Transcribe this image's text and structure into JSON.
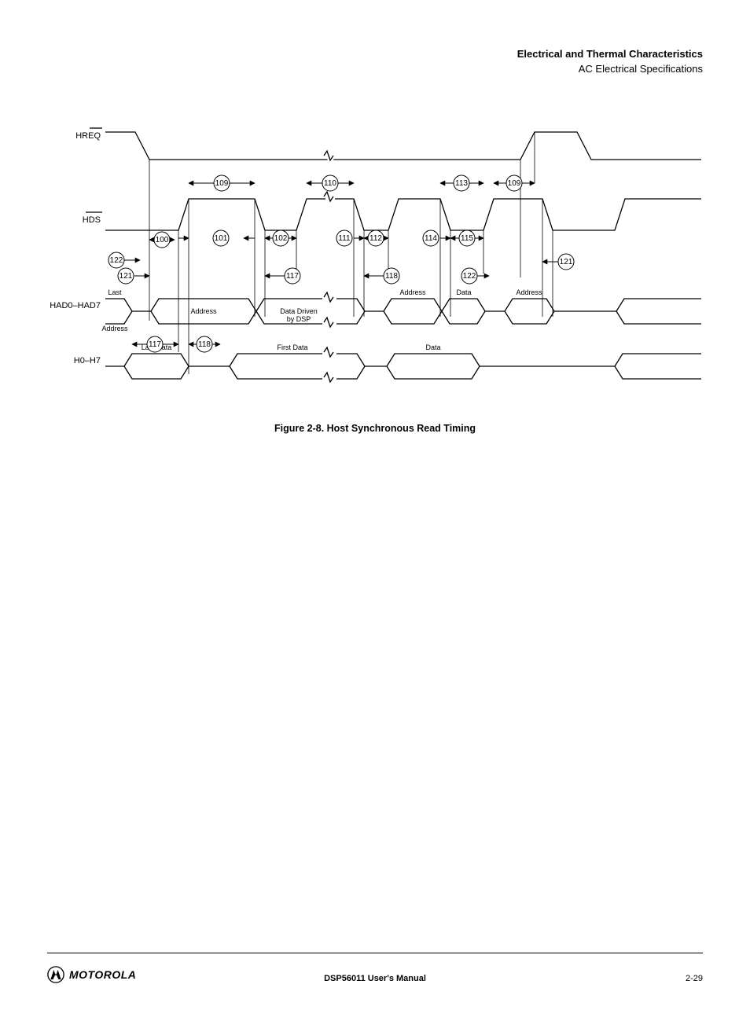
{
  "header": {
    "line1": "Electrical and Thermal Characteristics",
    "line2": "AC Electrical Specifications"
  },
  "figure": {
    "caption": "Figure 2-8.   Host Synchronous Read Timing",
    "signals": {
      "hreq": "HREQ",
      "hds": "HDS",
      "had": "HAD0–HAD7",
      "hdata": "H0–H7"
    },
    "segments": {
      "last_addr": "Last Address",
      "addr": "Address",
      "data_driven": "Data Driven by DSP",
      "data_driven_dsp": "by DSP",
      "data": "Data",
      "first_data": "First Data",
      "last_data": "Last Data",
      "address_short": "Address"
    },
    "timing_labels": {
      "t100": "100",
      "t101": "101",
      "t102": "102",
      "t109": "109",
      "t110": "110",
      "t111": "111",
      "t112": "112",
      "t113": "113",
      "t114": "114",
      "t115": "115",
      "t117": "117",
      "t118": "118",
      "t121": "121",
      "t122": "122"
    }
  },
  "footer": {
    "left_brand": "MOTOROLA",
    "center": "DSP56011 User's Manual",
    "right": "2-29"
  }
}
